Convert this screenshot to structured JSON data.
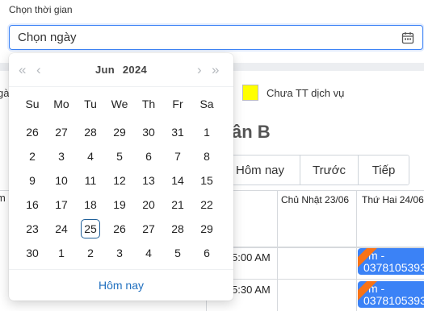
{
  "field": {
    "label": "Chọn thời gian",
    "placeholder": "Chọn ngày"
  },
  "background": {
    "legend_left_text": "gà",
    "legend_label": "Chưa TT dịch vụ",
    "room_title": "ân B",
    "left_strip_1": "",
    "left_strip_2": "m",
    "nav": {
      "today": "Hôm nay",
      "prev": "Trước",
      "next": "Tiếp"
    },
    "columns": [
      "Chủ Nhật 23/06",
      "Thứ Hai 24/06"
    ],
    "times": [
      "5:00 AM",
      "5:30 AM"
    ],
    "events": [
      {
        "line1": "m -",
        "line2": "0378105393"
      },
      {
        "line1": "m -",
        "line2": "0378105393"
      }
    ]
  },
  "datepicker": {
    "month": "Jun",
    "year": "2024",
    "weekdays": [
      "Su",
      "Mo",
      "Tu",
      "We",
      "Th",
      "Fr",
      "Sa"
    ],
    "days": [
      [
        "26",
        "27",
        "28",
        "29",
        "30",
        "31",
        "1"
      ],
      [
        "2",
        "3",
        "4",
        "5",
        "6",
        "7",
        "8"
      ],
      [
        "9",
        "10",
        "11",
        "12",
        "13",
        "14",
        "15"
      ],
      [
        "16",
        "17",
        "18",
        "19",
        "20",
        "21",
        "22"
      ],
      [
        "23",
        "24",
        "25",
        "26",
        "27",
        "28",
        "29"
      ],
      [
        "30",
        "1",
        "2",
        "3",
        "4",
        "5",
        "6"
      ]
    ],
    "today": "25",
    "footer": "Hôm nay"
  },
  "colors": {
    "accent": "#3b82f6",
    "legend_swatch": "#ffff00",
    "event_bg": "#3b82f6",
    "ribbon": "#f97316",
    "today_border": "#1f5f99",
    "footer_link": "#1f6fbf"
  }
}
